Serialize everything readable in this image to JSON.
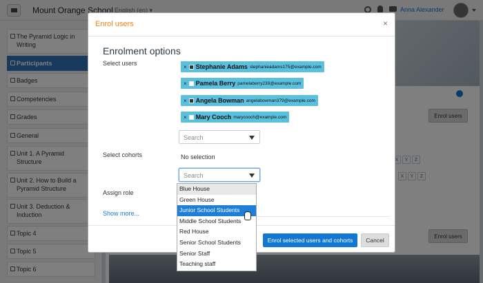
{
  "navbar": {
    "site_name": "Mount Orange School",
    "language": "English (en) ▾",
    "user_name": "Anna Alexander",
    "icons": [
      "menu-icon",
      "search-icon",
      "bell-icon",
      "chat-icon"
    ]
  },
  "drawer": {
    "items": [
      {
        "label": "The Pyramid Logic in Writing",
        "icon": "graduation-cap-icon"
      },
      {
        "label": "Participants",
        "icon": "users-icon",
        "active": true
      },
      {
        "label": "Badges",
        "icon": "badge-icon"
      },
      {
        "label": "Competencies",
        "icon": "check-square-icon"
      },
      {
        "label": "Grades",
        "icon": "table-icon"
      },
      {
        "label": "General",
        "icon": "folder-icon"
      },
      {
        "label": "Unit 1. A Pyramid Structure",
        "icon": "folder-icon"
      },
      {
        "label": "Unit 2. How to Build a Pyramid Structure",
        "icon": "folder-icon"
      },
      {
        "label": "Unit 3. Deduction & Induction",
        "icon": "folder-icon"
      },
      {
        "label": "Topic 4",
        "icon": "folder-icon"
      },
      {
        "label": "Topic 5",
        "icon": "folder-icon"
      },
      {
        "label": "Topic 6",
        "icon": "folder-icon"
      }
    ]
  },
  "background": {
    "enrol_button_label": "Enrol users",
    "letters_row1": [
      "X",
      "Y",
      "Z"
    ],
    "letters_row2": [
      "X",
      "Y",
      "Z"
    ]
  },
  "modal": {
    "title": "Enrol users",
    "close": "×",
    "section_title": "Enrolment options",
    "select_users_label": "Select users",
    "selected_users": [
      {
        "name": "Stephanie Adams",
        "email": "stephanieadams175@example.com",
        "remove": "×"
      },
      {
        "name": "Pamela Berry",
        "email": "pamelaberry239@example.com",
        "remove": "×"
      },
      {
        "name": "Angela Bowman",
        "email": "angelabowman379@example.com",
        "remove": "×"
      },
      {
        "name": "Mary Cooch",
        "email": "marycooch@example.com",
        "remove": "×"
      }
    ],
    "users_search_placeholder": "Search",
    "select_cohorts_label": "Select cohorts",
    "cohorts_no_selection": "No selection",
    "cohorts_search_placeholder": "Search",
    "assign_role_label": "Assign role",
    "show_more": "Show more...",
    "primary_button": "Enrol selected users and cohorts",
    "cancel_button": "Cancel"
  },
  "cohort_dropdown": {
    "options": [
      "Blue House",
      "Green House",
      "Junior School Students",
      "Middle School Students",
      "Red House",
      "Senior School Students",
      "Senior Staff",
      "Teaching staff"
    ],
    "hovered_index": 0,
    "selected_index": 2
  },
  "colors": {
    "accent_orange": "#f98012",
    "primary_blue": "#1177d1",
    "chip_blue": "#5bc0de",
    "drawer_active": "#2f72b6"
  }
}
